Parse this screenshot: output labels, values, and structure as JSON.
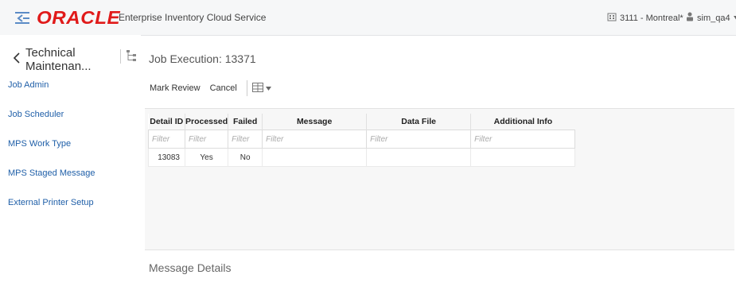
{
  "header": {
    "logo": "ORACLE",
    "app_title": "Enterprise Inventory Cloud Service",
    "store": "3111 - Montreal*",
    "user": "sim_qa4"
  },
  "sidebar": {
    "back_label": "Technical Maintenan...",
    "items": [
      {
        "label": "Job Admin"
      },
      {
        "label": "Job Scheduler"
      },
      {
        "label": "MPS Work Type"
      },
      {
        "label": "MPS Staged Message"
      },
      {
        "label": "External Printer Setup"
      }
    ]
  },
  "main": {
    "title": "Job Execution: 13371",
    "toolbar": {
      "mark_review": "Mark Review",
      "cancel": "Cancel"
    },
    "table": {
      "columns": [
        "Detail ID",
        "Processed",
        "Failed",
        "Message",
        "Data File",
        "Additional Info"
      ],
      "filter_placeholder": "Filter",
      "rows": [
        {
          "detail_id": "13083",
          "processed": "Yes",
          "failed": "No",
          "message": "",
          "data_file": "",
          "additional_info": ""
        }
      ]
    },
    "message_details_label": "Message Details"
  }
}
